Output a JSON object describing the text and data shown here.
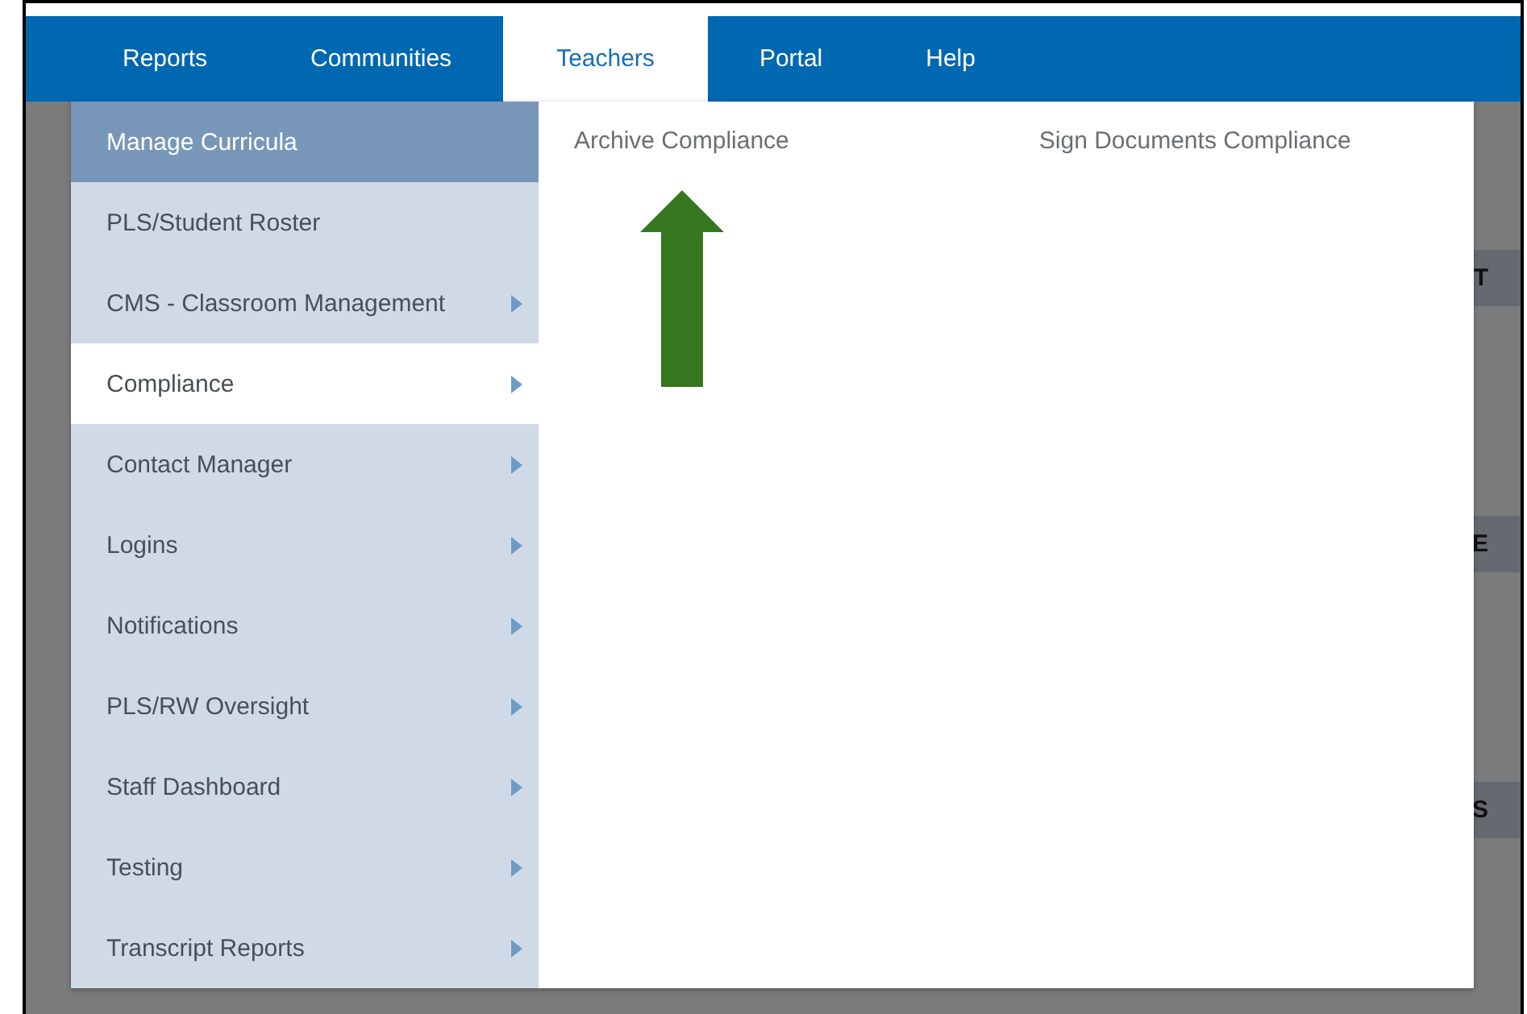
{
  "nav": {
    "tabs": [
      {
        "label": "Reports",
        "selected": false
      },
      {
        "label": "Communities",
        "selected": false
      },
      {
        "label": "Teachers",
        "selected": true
      },
      {
        "label": "Portal",
        "selected": false
      },
      {
        "label": "Help",
        "selected": false
      }
    ]
  },
  "background_panels": [
    {
      "heading": "T"
    },
    {
      "heading": "E"
    },
    {
      "heading": "S"
    }
  ],
  "menu": {
    "items": [
      {
        "label": "Manage Curricula",
        "highlighted": true,
        "selected": false,
        "has_submenu": false
      },
      {
        "label": "PLS/Student Roster",
        "highlighted": false,
        "selected": false,
        "has_submenu": false
      },
      {
        "label": "CMS - Classroom Management",
        "highlighted": false,
        "selected": false,
        "has_submenu": true
      },
      {
        "label": "Compliance",
        "highlighted": false,
        "selected": true,
        "has_submenu": true
      },
      {
        "label": "Contact Manager",
        "highlighted": false,
        "selected": false,
        "has_submenu": true
      },
      {
        "label": "Logins",
        "highlighted": false,
        "selected": false,
        "has_submenu": true
      },
      {
        "label": "Notifications",
        "highlighted": false,
        "selected": false,
        "has_submenu": true
      },
      {
        "label": "PLS/RW Oversight",
        "highlighted": false,
        "selected": false,
        "has_submenu": true
      },
      {
        "label": "Staff Dashboard",
        "highlighted": false,
        "selected": false,
        "has_submenu": true
      },
      {
        "label": "Testing",
        "highlighted": false,
        "selected": false,
        "has_submenu": true
      },
      {
        "label": "Transcript Reports",
        "highlighted": false,
        "selected": false,
        "has_submenu": true
      }
    ],
    "submenu": [
      "Archive Compliance",
      "Sign Documents Compliance"
    ]
  }
}
